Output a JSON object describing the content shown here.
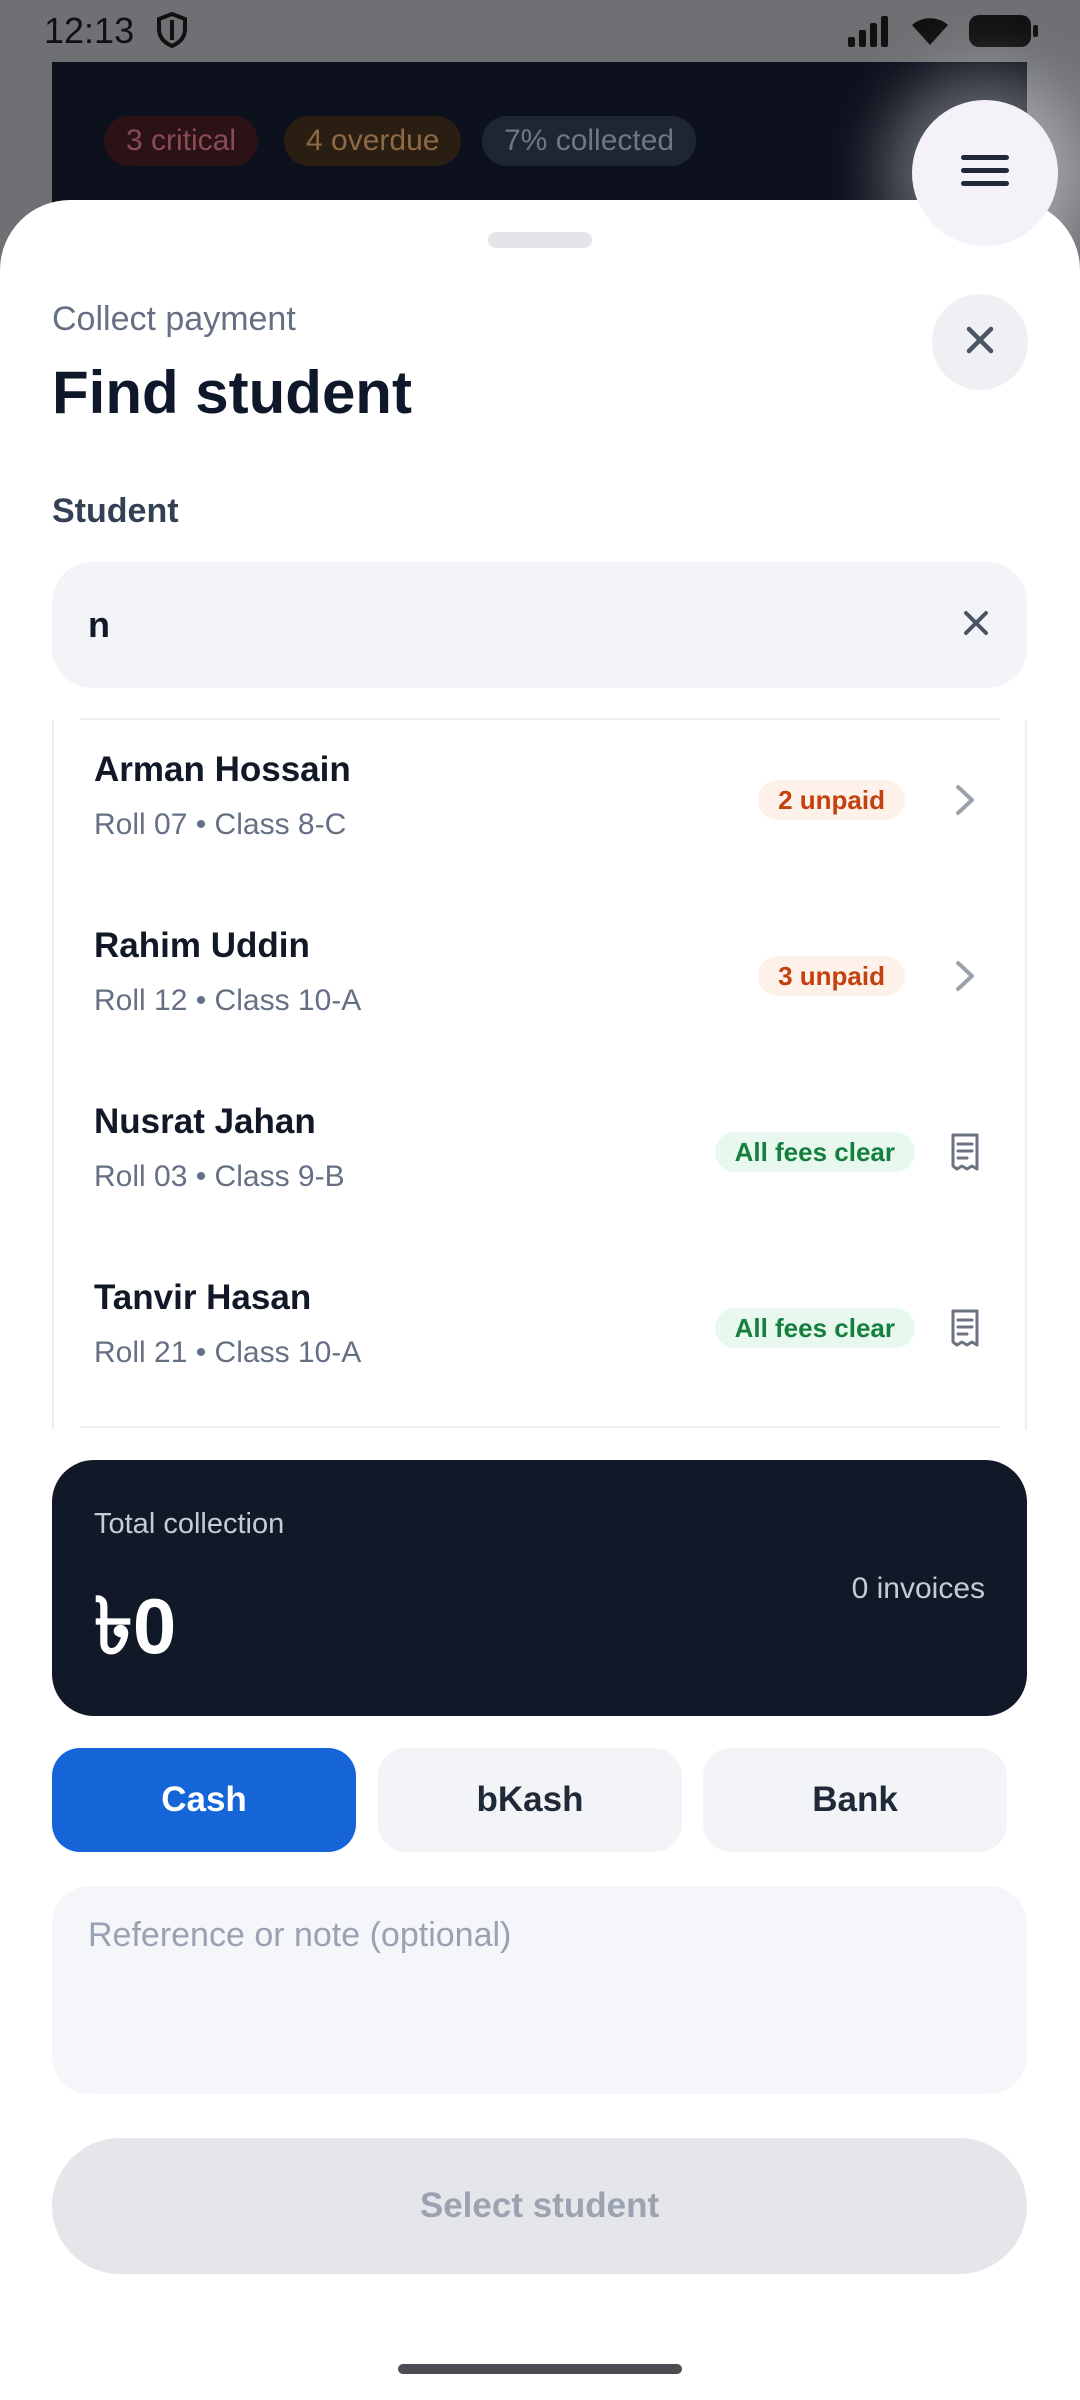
{
  "status_bar": {
    "time": "12:13"
  },
  "background": {
    "chips": [
      "3 critical",
      "4 overdue",
      "7% collected"
    ]
  },
  "sheet": {
    "overline": "Collect payment",
    "title": "Find student",
    "field_label": "Student",
    "search": {
      "value": "n"
    },
    "results": [
      {
        "name": "Arman Hossain",
        "sub": "Roll 07 • Class 8-C",
        "badge": "2 unpaid",
        "status": "unpaid",
        "icon": "chevron-right-icon"
      },
      {
        "name": "Rahim Uddin",
        "sub": "Roll 12 • Class 10-A",
        "badge": "3 unpaid",
        "status": "unpaid",
        "icon": "chevron-right-icon"
      },
      {
        "name": "Nusrat Jahan",
        "sub": "Roll 03 • Class 9-B",
        "badge": "All fees clear",
        "status": "clear",
        "icon": "receipt-icon"
      },
      {
        "name": "Tanvir Hasan",
        "sub": "Roll 21 • Class 10-A",
        "badge": "All fees clear",
        "status": "clear",
        "icon": "receipt-icon"
      }
    ],
    "total": {
      "label": "Total collection",
      "amount": "৳0",
      "invoices": "0 invoices"
    },
    "methods": [
      "Cash",
      "bKash",
      "Bank"
    ],
    "selected_method": "Cash",
    "note": {
      "placeholder": "Reference or note (optional)"
    },
    "submit_label": "Select student"
  },
  "colors": {
    "primary": "#1565d8",
    "dark_card": "#111827",
    "unpaid": "#c2410c",
    "clear": "#15803d"
  }
}
